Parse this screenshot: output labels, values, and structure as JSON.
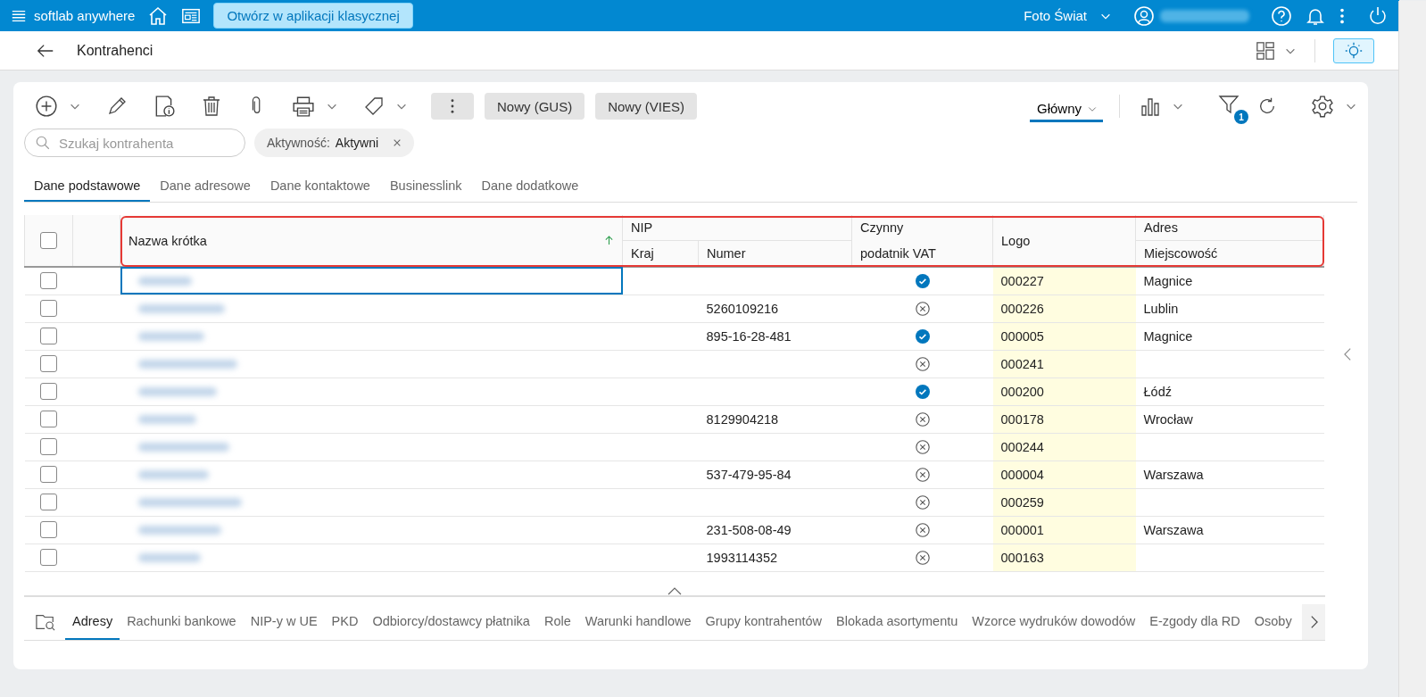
{
  "topbar": {
    "app_name": "softlab anywhere",
    "open_button": "Otwórz w aplikacji klasycznej",
    "company": "Foto Świat"
  },
  "page": {
    "title": "Kontrahenci"
  },
  "toolbar": {
    "buttons": [
      "Nowy (GUS)",
      "Nowy (VIES)"
    ],
    "view": "Główny",
    "filter_count": "1"
  },
  "search": {
    "placeholder": "Szukaj kontrahenta"
  },
  "filter_chip": {
    "label": "Aktywność:",
    "value": "Aktywni"
  },
  "tabs": [
    {
      "label": "Dane podstawowe",
      "selected": true
    },
    {
      "label": "Dane adresowe",
      "selected": false
    },
    {
      "label": "Dane kontaktowe",
      "selected": false
    },
    {
      "label": "Businesslink",
      "selected": false
    },
    {
      "label": "Dane dodatkowe",
      "selected": false
    }
  ],
  "table": {
    "select_all_checked": false,
    "columns": {
      "name": "Nazwa krótka",
      "nip": "NIP",
      "nip_country": "Kraj",
      "nip_number": "Numer",
      "vat_top": "Czynny",
      "vat_bottom": "podatnik VAT",
      "logo": "Logo",
      "address": "Adres",
      "city": "Miejscowość"
    },
    "rows": [
      {
        "checked": false,
        "focused": true,
        "nip": "",
        "vat_active": true,
        "logo": "000227",
        "city": "Magnice"
      },
      {
        "checked": false,
        "focused": false,
        "nip": "5260109216",
        "vat_active": false,
        "logo": "000226",
        "city": "Lublin"
      },
      {
        "checked": false,
        "focused": false,
        "nip": "895-16-28-481",
        "vat_active": true,
        "logo": "000005",
        "city": "Magnice"
      },
      {
        "checked": false,
        "focused": false,
        "nip": "",
        "vat_active": false,
        "logo": "000241",
        "city": ""
      },
      {
        "checked": false,
        "focused": false,
        "nip": "",
        "vat_active": true,
        "logo": "000200",
        "city": "Łódź"
      },
      {
        "checked": false,
        "focused": false,
        "nip": "8129904218",
        "vat_active": false,
        "logo": "000178",
        "city": "Wrocław"
      },
      {
        "checked": false,
        "focused": false,
        "nip": "",
        "vat_active": false,
        "logo": "000244",
        "city": ""
      },
      {
        "checked": false,
        "focused": false,
        "nip": "537-479-95-84",
        "vat_active": false,
        "logo": "000004",
        "city": "Warszawa"
      },
      {
        "checked": false,
        "focused": false,
        "nip": "",
        "vat_active": false,
        "logo": "000259",
        "city": ""
      },
      {
        "checked": false,
        "focused": false,
        "nip": "231-508-08-49",
        "vat_active": false,
        "logo": "000001",
        "city": "Warszawa"
      },
      {
        "checked": false,
        "focused": false,
        "nip": "1993114352",
        "vat_active": false,
        "logo": "000163",
        "city": ""
      }
    ]
  },
  "bottom_tabs": [
    {
      "label": "Adresy",
      "selected": true
    },
    {
      "label": "Rachunki bankowe",
      "selected": false
    },
    {
      "label": "NIP-y w UE",
      "selected": false
    },
    {
      "label": "PKD",
      "selected": false
    },
    {
      "label": "Odbiorcy/dostawcy płatnika",
      "selected": false
    },
    {
      "label": "Role",
      "selected": false
    },
    {
      "label": "Warunki handlowe",
      "selected": false
    },
    {
      "label": "Grupy kontrahentów",
      "selected": false
    },
    {
      "label": "Blokada asortymentu",
      "selected": false
    },
    {
      "label": "Wzorce wydruków dowodów",
      "selected": false
    },
    {
      "label": "E-zgody dla RD",
      "selected": false
    },
    {
      "label": "Osoby",
      "selected": false
    }
  ]
}
